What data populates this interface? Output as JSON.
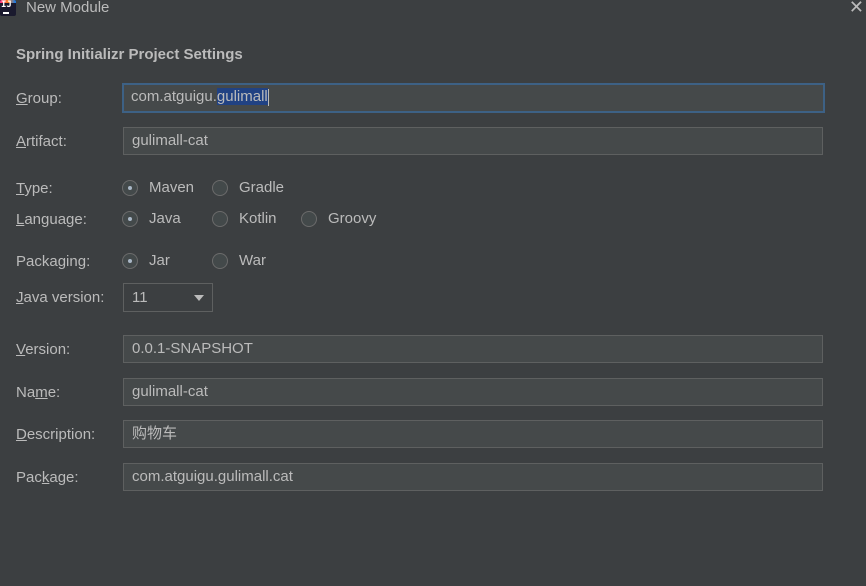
{
  "window": {
    "title": "New Module"
  },
  "section_title": "Spring Initializr Project Settings",
  "fields": {
    "group": {
      "label_u": "G",
      "label_rest": "roup:",
      "value_plain": "com.atguigu.",
      "value_selected": "gulimall"
    },
    "artifact": {
      "label_u": "A",
      "label_rest": "rtifact:",
      "value": "gulimall-cat"
    },
    "version": {
      "label_u": "V",
      "label_rest": "ersion:",
      "value": "0.0.1-SNAPSHOT"
    },
    "name": {
      "label_pre": "Na",
      "label_u": "m",
      "label_rest": "e:",
      "value": "gulimall-cat"
    },
    "description": {
      "label_u": "D",
      "label_rest": "escription:",
      "value": "购物车"
    },
    "package": {
      "label_pre": "Pac",
      "label_u": "k",
      "label_rest": "age:",
      "value": "com.atguigu.gulimall.cat"
    }
  },
  "type": {
    "label_u": "T",
    "label_rest": "ype:",
    "options": [
      "Maven",
      "Gradle"
    ],
    "selected": "Maven"
  },
  "language": {
    "label_u": "L",
    "label_rest": "anguage:",
    "options": [
      "Java",
      "Kotlin",
      "Groovy"
    ],
    "selected": "Java"
  },
  "packaging": {
    "label_pre": "Packa",
    "label_u": "g",
    "label_rest": "ing:",
    "options": [
      "Jar",
      "War"
    ],
    "selected": "Jar"
  },
  "java_version": {
    "label_u": "J",
    "label_rest": "ava version:",
    "value": "11"
  },
  "icons": {
    "app": "intellij-idea-icon",
    "close": "close-icon",
    "dropdown": "chevron-down-icon"
  }
}
